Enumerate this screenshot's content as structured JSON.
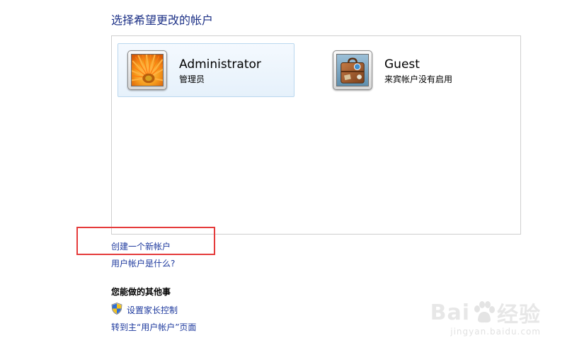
{
  "header": {
    "title": "选择希望更改的帐户"
  },
  "accounts": [
    {
      "name": "Administrator",
      "subtitle": "管理员",
      "avatar": "orange-flower-avatar"
    },
    {
      "name": "Guest",
      "subtitle": "来宾帐户没有启用",
      "avatar": "suitcase-avatar"
    }
  ],
  "links": {
    "create_account": "创建一个新帐户",
    "what_is_account": "用户帐户是什么?"
  },
  "other_tasks": {
    "heading": "您能做的其他事",
    "parental_controls": "设置家长控制",
    "parental_icon": "shield-icon",
    "go_main": "转到主“用户帐户”页面"
  },
  "watermark": {
    "logo": "Bai 经验",
    "url": "jingyan.baidu.com"
  },
  "colors": {
    "title": "#1e3287",
    "link": "#1e3a9e",
    "highlight": "#e53b3b",
    "selected_tile": "#e6f1fb"
  }
}
